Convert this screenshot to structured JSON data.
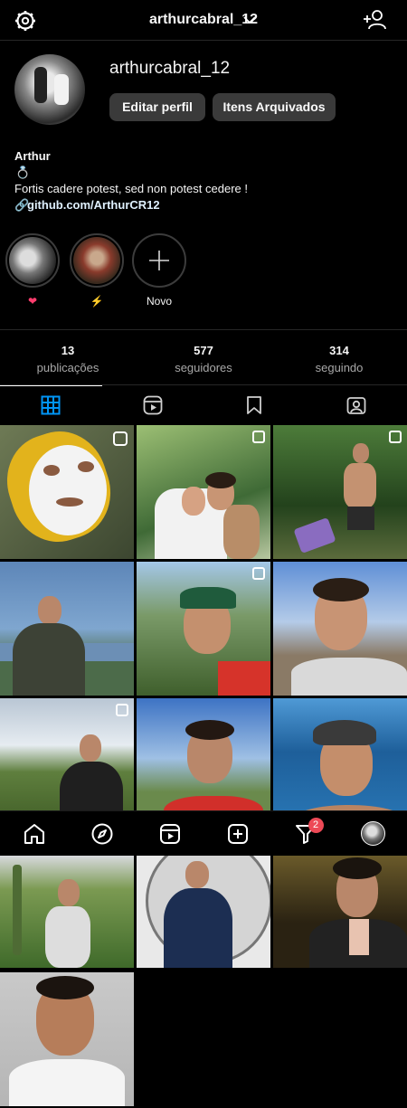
{
  "header": {
    "username": "arthurcabral_12"
  },
  "profile": {
    "username": "arthurcabral_12",
    "edit_label": "Editar perfil",
    "archive_label": "Itens Arquivados",
    "display_name": "Arthur",
    "bio_emoji": "💍",
    "bio_text": "Fortis cadere potest, sed non potest cedere !",
    "link": "github.com/ArthurCR12"
  },
  "highlights": [
    {
      "label": "❤"
    },
    {
      "label": "⚡"
    },
    {
      "label": "Novo"
    }
  ],
  "stats": [
    {
      "value": "13",
      "label": "publicações"
    },
    {
      "value": "577",
      "label": "seguidores"
    },
    {
      "value": "314",
      "label": "seguindo"
    }
  ],
  "nav": {
    "badge_count": "2"
  },
  "colors": {
    "background": "#000000",
    "button": "#3a3a3a",
    "active_tab": "#0095f6",
    "badge": "#ed4956"
  }
}
